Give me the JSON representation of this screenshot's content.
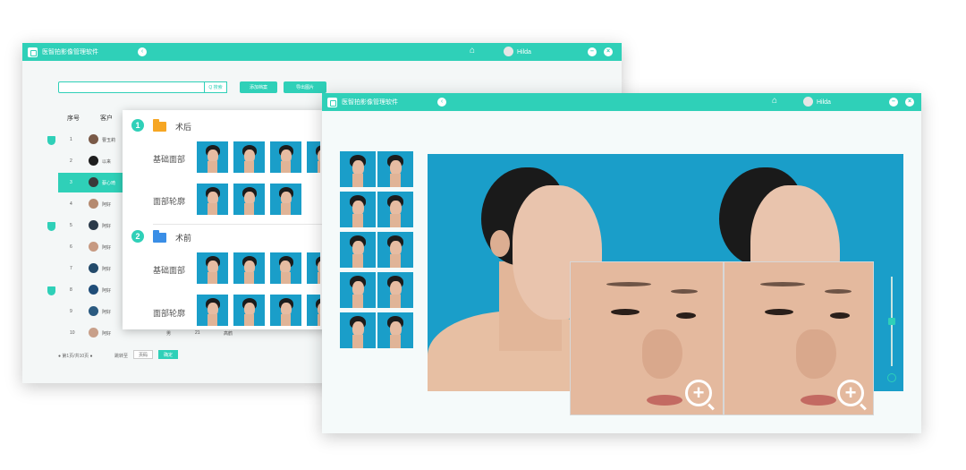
{
  "windowA": {
    "title": "医智拍影像管理软件",
    "user": "Hilda",
    "search_button": "Q 搜索",
    "toolbar": {
      "btn1": "添加档案",
      "btn2": "导出图片"
    },
    "table_headers": {
      "col1": "序号",
      "col2": "客户"
    },
    "rows": [
      {
        "num": "1",
        "name": "曹玉莉"
      },
      {
        "num": "2",
        "name": "以来"
      },
      {
        "num": "3",
        "name": "蔡心琦"
      },
      {
        "num": "4",
        "name": "阿好"
      },
      {
        "num": "5",
        "name": "阿好"
      },
      {
        "num": "6",
        "name": "阿好"
      },
      {
        "num": "7",
        "name": "阿好"
      },
      {
        "num": "8",
        "name": "阿好"
      },
      {
        "num": "9",
        "name": "阿好"
      },
      {
        "num": "10",
        "name": "阿好"
      }
    ],
    "row10_extra": {
      "gender": "男",
      "age": "21",
      "status": "高鹤"
    },
    "pager": {
      "left": "● 第1页/共10页 ●",
      "goto_label": "跳转至",
      "page_input": "页码",
      "go": "确定"
    },
    "popup": {
      "section1": {
        "badge": "1",
        "label": "术后",
        "cat1": "基础面部",
        "cat2": "面部轮廓"
      },
      "section2": {
        "badge": "2",
        "label": "术前",
        "cat1": "基础面部",
        "cat2": "面部轮廓"
      }
    }
  },
  "windowB": {
    "title": "医智拍影像管理软件",
    "user": "Hilda"
  },
  "colors": {
    "accent": "#2fd0b8",
    "photo_bg": "#1a9ec9",
    "folder1": "#f6a623",
    "folder2": "#3a8ee6"
  },
  "icons": [
    "logo-icon",
    "back-icon",
    "home-icon",
    "avatar",
    "minimize-icon",
    "close-icon",
    "shield-icon",
    "folder-icon",
    "zoom-in-icon"
  ]
}
